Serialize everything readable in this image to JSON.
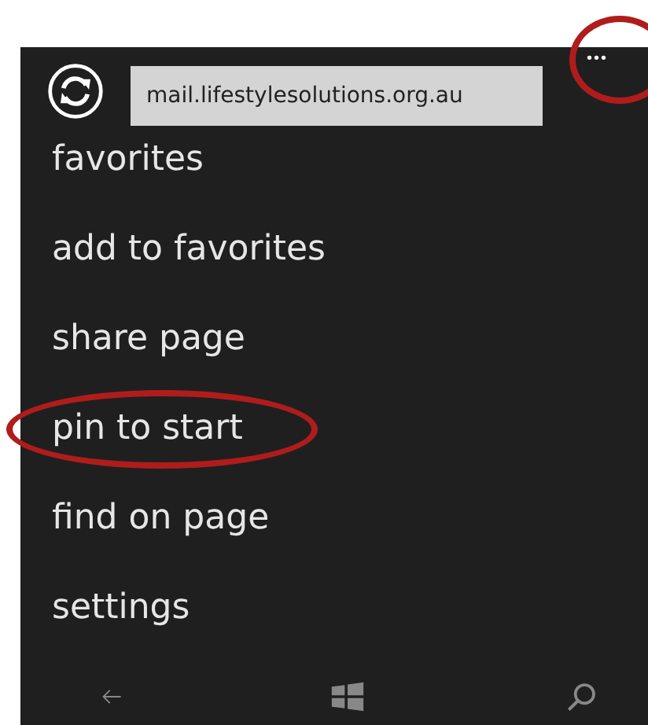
{
  "address_bar": {
    "value": "mail.lifestylesolutions.org.au"
  },
  "more_button": {
    "label": "•••"
  },
  "menu": [
    {
      "label": "favorites",
      "highlighted": false
    },
    {
      "label": "add to favorites",
      "highlighted": false
    },
    {
      "label": "share page",
      "highlighted": false
    },
    {
      "label": "pin to start",
      "highlighted": true
    },
    {
      "label": "find on page",
      "highlighted": false
    },
    {
      "label": "settings",
      "highlighted": false
    }
  ],
  "more_button_highlighted": true
}
